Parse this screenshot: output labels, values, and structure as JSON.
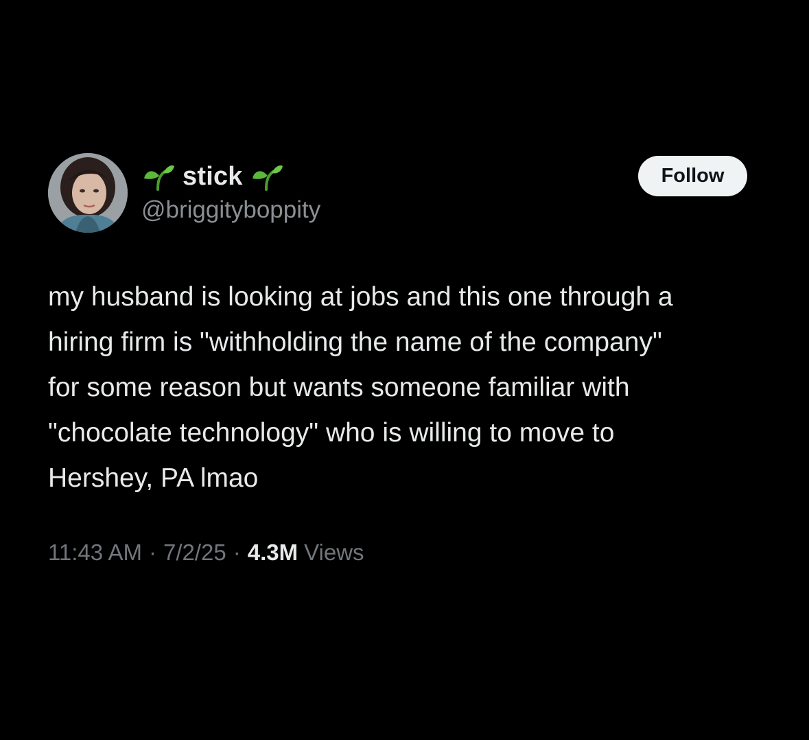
{
  "author": {
    "display_name": "stick",
    "handle": "@briggityboppity",
    "name_decoration_icon": "seedling-icon"
  },
  "follow_button": {
    "label": "Follow"
  },
  "tweet": {
    "text_lines": [
      "my husband is looking at jobs and this one through a",
      "hiring firm is \"withholding the name of the company\"",
      "for some reason but wants someone familiar with",
      "\"chocolate technology\" who is willing to move to",
      "Hershey, PA lmao"
    ]
  },
  "meta": {
    "time": "11:43 AM",
    "separator": "·",
    "date": "7/2/25",
    "views_count": "4.3M",
    "views_label": "Views"
  },
  "colors": {
    "background": "#000000",
    "primary_text": "#e7e9ea",
    "secondary_text": "#71767b",
    "follow_bg": "#eff3f4",
    "seedling_green": "#5cb83a"
  }
}
